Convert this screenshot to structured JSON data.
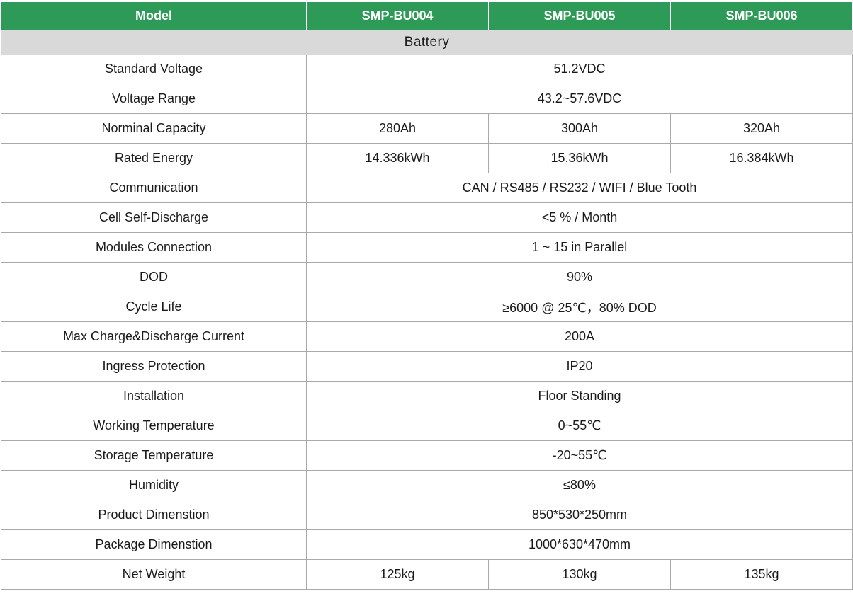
{
  "header": {
    "model_label": "Model",
    "models": [
      "SMP-BU004",
      "SMP-BU005",
      "SMP-BU006"
    ]
  },
  "section": {
    "title": "Battery"
  },
  "rows": [
    {
      "label": "Standard Voltage",
      "value": "51.2VDC"
    },
    {
      "label": "Voltage Range",
      "value": "43.2~57.6VDC"
    },
    {
      "label": "Norminal Capacity",
      "values": [
        "280Ah",
        "300Ah",
        "320Ah"
      ]
    },
    {
      "label": "Rated Energy",
      "values": [
        "14.336kWh",
        "15.36kWh",
        "16.384kWh"
      ]
    },
    {
      "label": "Communication",
      "value": "CAN / RS485 /  RS232 / WIFI / Blue Tooth"
    },
    {
      "label": "Cell Self-Discharge",
      "value": "<5 % / Month"
    },
    {
      "label": "Modules Connection",
      "value": "1 ~ 15 in Parallel"
    },
    {
      "label": "DOD",
      "value": "90%"
    },
    {
      "label": "Cycle Life",
      "value": "≥6000 @ 25℃，80% DOD"
    },
    {
      "label": "Max Charge&Discharge Current",
      "value": "200A"
    },
    {
      "label": "Ingress Protection",
      "value": "IP20"
    },
    {
      "label": "Installation",
      "value": "Floor Standing"
    },
    {
      "label": "Working Temperature",
      "value": "0~55℃"
    },
    {
      "label": "Storage Temperature",
      "value": "-20~55℃"
    },
    {
      "label": "Humidity",
      "value": "≤80%"
    },
    {
      "label": "Product Dimenstion",
      "value": "850*530*250mm"
    },
    {
      "label": "Package Dimenstion",
      "value": "1000*630*470mm"
    },
    {
      "label": "Net Weight",
      "values": [
        "125kg",
        "130kg",
        "135kg"
      ]
    }
  ],
  "colors": {
    "header_bg": "#2e9a57",
    "section_bg": "#d9d9d9",
    "border": "#a9a9a9"
  }
}
